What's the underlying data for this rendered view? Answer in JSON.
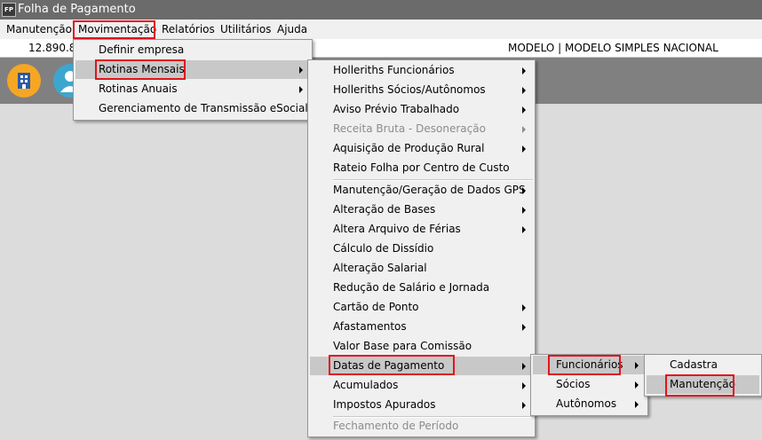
{
  "window": {
    "title": "Folha de Pagamento",
    "icon_text": "FP"
  },
  "menubar": {
    "items": [
      "Manutenção",
      "Movimentação",
      "Relatórios",
      "Utilitários",
      "Ajuda"
    ]
  },
  "infobar": {
    "value": "12.890.8",
    "model": "MODELO | MODELO SIMPLES NACIONAL"
  },
  "menu_movimentacao": {
    "items": [
      "Definir empresa",
      "Rotinas Mensais",
      "Rotinas Anuais",
      "Gerenciamento de Transmissão eSocial"
    ]
  },
  "menu_rotinas_mensais": {
    "items": [
      "Holleriths Funcionários",
      "Holleriths Sócios/Autônomos",
      "Aviso Prévio Trabalhado",
      "Receita Bruta - Desoneração",
      "Aquisição de Produção Rural",
      "Rateio Folha por Centro de Custo",
      "Manutenção/Geração de Dados GPS",
      "Alteração de Bases",
      "Altera Arquivo de Férias",
      "Cálculo de Dissídio",
      "Alteração Salarial",
      "Redução de Salário e Jornada",
      "Cartão de Ponto",
      "Afastamentos",
      "Valor Base para Comissão",
      "Datas de Pagamento",
      "Acumulados",
      "Impostos Apurados",
      "Fechamento de Período"
    ]
  },
  "menu_datas_pagamento": {
    "items": [
      "Funcionários",
      "Sócios",
      "Autônomos"
    ]
  },
  "menu_funcionarios": {
    "items": [
      "Cadastra",
      "Manutenção"
    ]
  },
  "colors": {
    "titlebar": "#6b6b6b",
    "highlight": "#c8c8c8",
    "annotation": "#e1141e",
    "toolbar": "#808080"
  }
}
